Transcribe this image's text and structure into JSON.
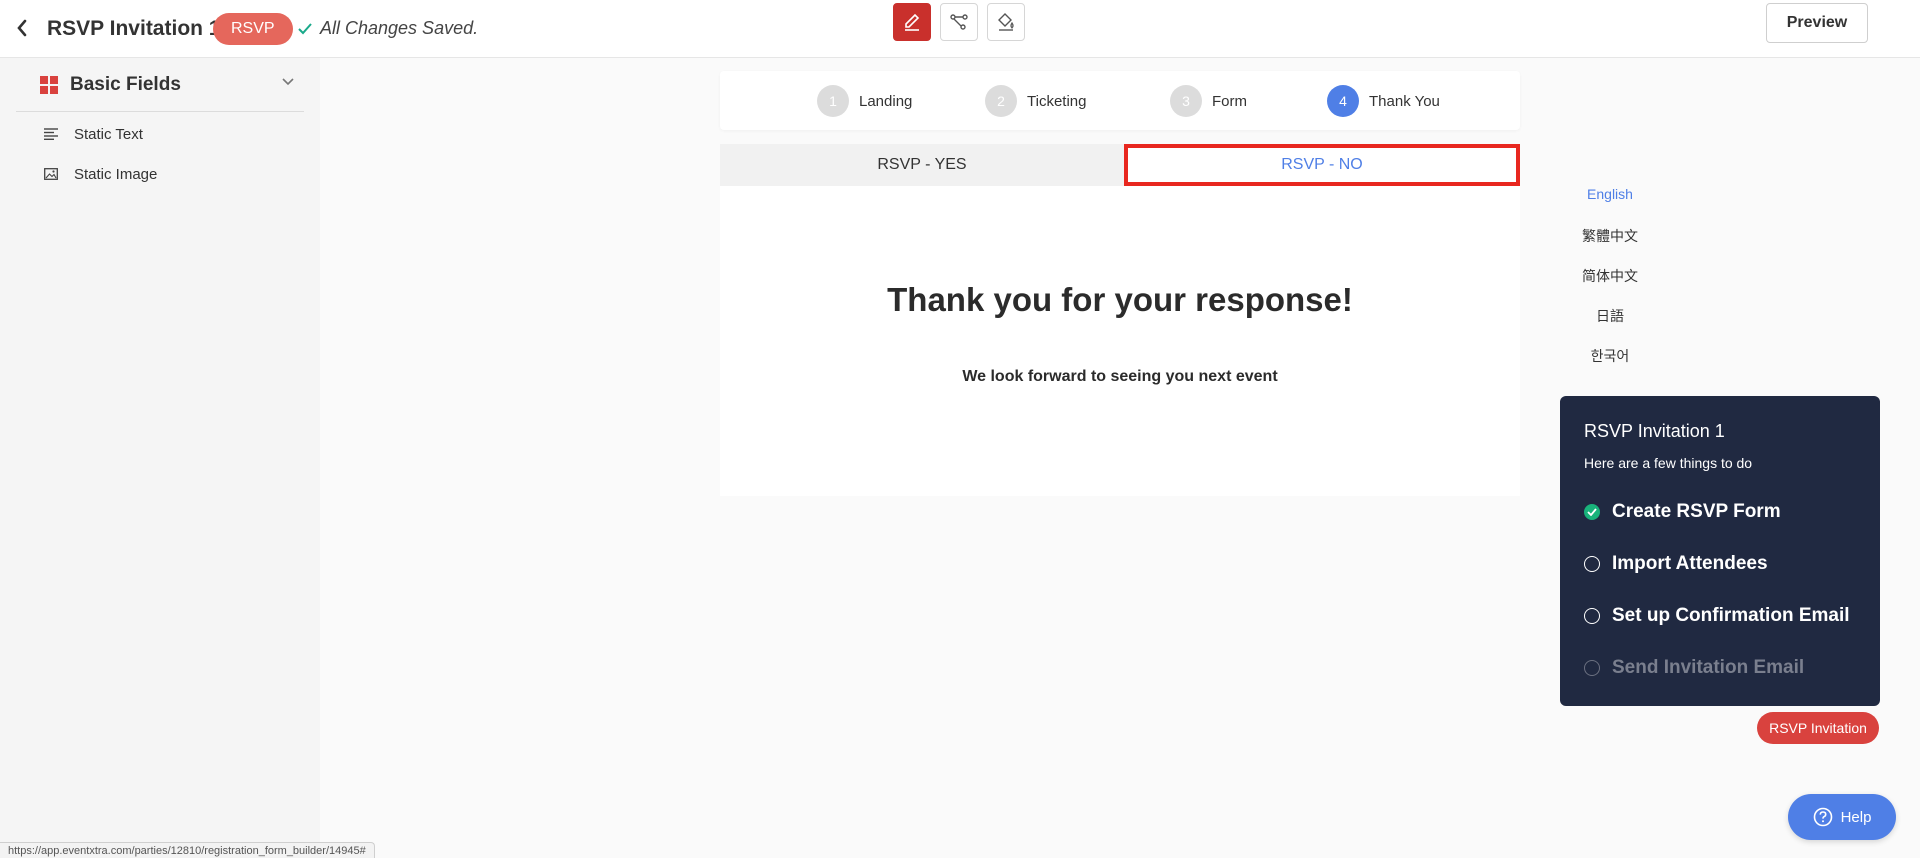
{
  "header": {
    "title": "RSVP Invitation 1",
    "badge": "RSVP",
    "save_status": "All Changes Saved.",
    "preview_label": "Preview",
    "colors": {
      "brand_red": "#c9302c",
      "badge_red": "#e5675c"
    }
  },
  "sidebar": {
    "section_label": "Basic Fields",
    "items": [
      {
        "label": "Static Text",
        "icon": "text-lines-icon"
      },
      {
        "label": "Static Image",
        "icon": "image-icon"
      }
    ]
  },
  "steps": [
    {
      "num": "1",
      "label": "Landing"
    },
    {
      "num": "2",
      "label": "Ticketing"
    },
    {
      "num": "3",
      "label": "Form"
    },
    {
      "num": "4",
      "label": "Thank You"
    }
  ],
  "tabs": {
    "yes": "RSVP - YES",
    "no": "RSVP - NO"
  },
  "content": {
    "heading": "Thank you for your response!",
    "message": "We look forward to seeing you next event"
  },
  "languages": [
    "English",
    "繁體中文",
    "简体中文",
    "日語",
    "한국어"
  ],
  "todo": {
    "title": "RSVP Invitation 1",
    "subtitle": "Here are a few things to do",
    "items": [
      {
        "label": "Create RSVP Form",
        "state": "done"
      },
      {
        "label": "Import Attendees",
        "state": "open"
      },
      {
        "label": "Set up Confirmation Email",
        "state": "open"
      },
      {
        "label": "Send Invitation Email",
        "state": "disabled"
      }
    ]
  },
  "rsvp_invitation_button": "RSVP Invitation",
  "help_label": "Help",
  "status_url": "https://app.eventxtra.com/parties/12810/registration_form_builder/14945#"
}
